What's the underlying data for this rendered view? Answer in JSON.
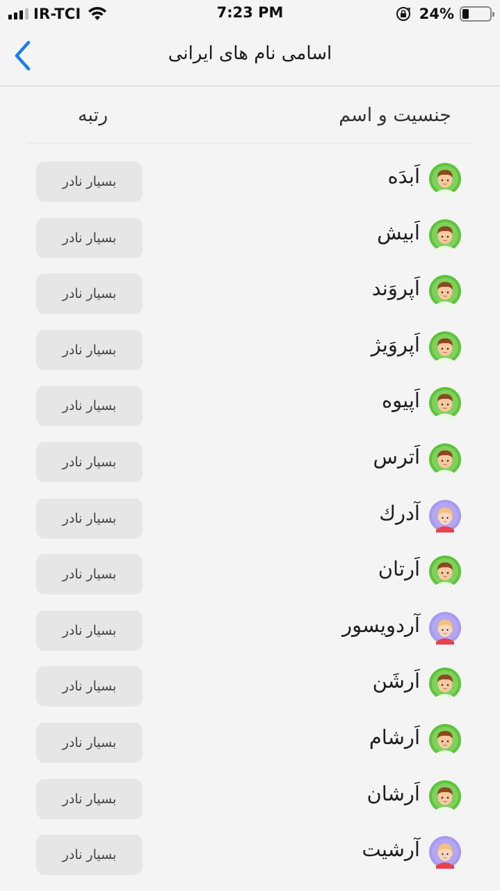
{
  "status_bar": {
    "carrier": "IR-TCI",
    "time": "7:23 PM",
    "battery_percent": "24%",
    "battery_level": 0.24
  },
  "nav": {
    "title": "اسامی نام های ایرانی",
    "back_icon": "chevron-left-icon",
    "accent_color": "#1a7df0"
  },
  "table": {
    "header": {
      "name_column": "جنسیت و اسم",
      "rank_column": "رتبه"
    },
    "rows": [
      {
        "name": "اَبدَه",
        "gender": "male",
        "rank": "بسیار نادر"
      },
      {
        "name": "اَبیش",
        "gender": "male",
        "rank": "بسیار نادر"
      },
      {
        "name": "اَپروَند",
        "gender": "male",
        "rank": "بسیار نادر"
      },
      {
        "name": "اَپروَیژ",
        "gender": "male",
        "rank": "بسیار نادر"
      },
      {
        "name": "اَپیوه",
        "gender": "male",
        "rank": "بسیار نادر"
      },
      {
        "name": "اَترس",
        "gender": "male",
        "rank": "بسیار نادر"
      },
      {
        "name": "آدرك",
        "gender": "female",
        "rank": "بسیار نادر"
      },
      {
        "name": "اَرتان",
        "gender": "male",
        "rank": "بسیار نادر"
      },
      {
        "name": "آردویسور",
        "gender": "female",
        "rank": "بسیار نادر"
      },
      {
        "name": "اَرشَن",
        "gender": "male",
        "rank": "بسیار نادر"
      },
      {
        "name": "اَرشام",
        "gender": "male",
        "rank": "بسیار نادر"
      },
      {
        "name": "اَرشان",
        "gender": "male",
        "rank": "بسیار نادر"
      },
      {
        "name": "آرشیت",
        "gender": "female",
        "rank": "بسیار نادر"
      }
    ]
  },
  "colors": {
    "male_avatar_ring": "#5cc43a",
    "female_avatar_ring": "#a89af0"
  }
}
